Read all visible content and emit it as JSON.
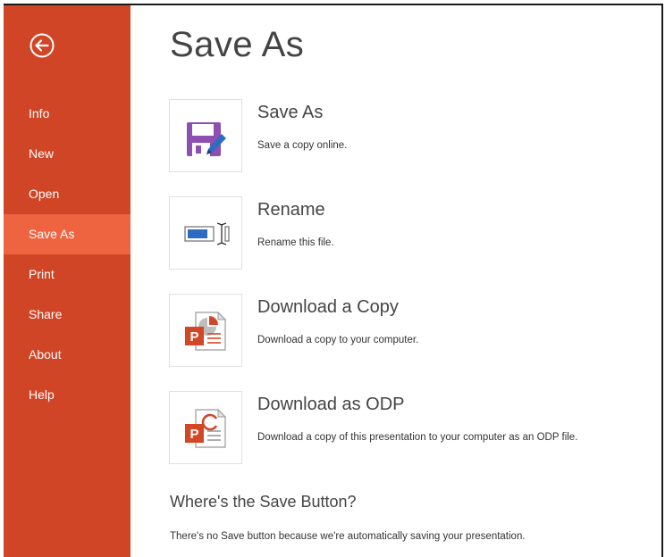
{
  "sidebar": {
    "back_icon": "circle-left-arrow-icon",
    "items": [
      {
        "label": "Info"
      },
      {
        "label": "New"
      },
      {
        "label": "Open"
      },
      {
        "label": "Save As"
      },
      {
        "label": "Print"
      },
      {
        "label": "Share"
      },
      {
        "label": "About"
      },
      {
        "label": "Help"
      }
    ],
    "active_item": "Save As"
  },
  "main": {
    "title": "Save As",
    "options": [
      {
        "title": "Save As",
        "description": "Save a copy online.",
        "icon": "floppy-disk-pencil-icon"
      },
      {
        "title": "Rename",
        "description": "Rename this file.",
        "icon": "rename-textbox-icon"
      },
      {
        "title": "Download a Copy",
        "description": "Download a copy to your computer.",
        "icon": "powerpoint-file-icon"
      },
      {
        "title": "Download as ODP",
        "description": "Download a copy of this presentation to your computer as an ODP file.",
        "icon": "powerpoint-odp-file-icon"
      }
    ],
    "help_heading": "Where's the Save Button?",
    "help_text": "There's no Save button because we're automatically saving your presentation."
  },
  "colors": {
    "sidebar_bg": "#d04526",
    "sidebar_active_bg": "#ee6441",
    "text_main": "#444444",
    "floppy_purple": "#8d4fb1",
    "pencil_blue": "#2e6cc4",
    "powerpoint_orange": "#d24726"
  }
}
